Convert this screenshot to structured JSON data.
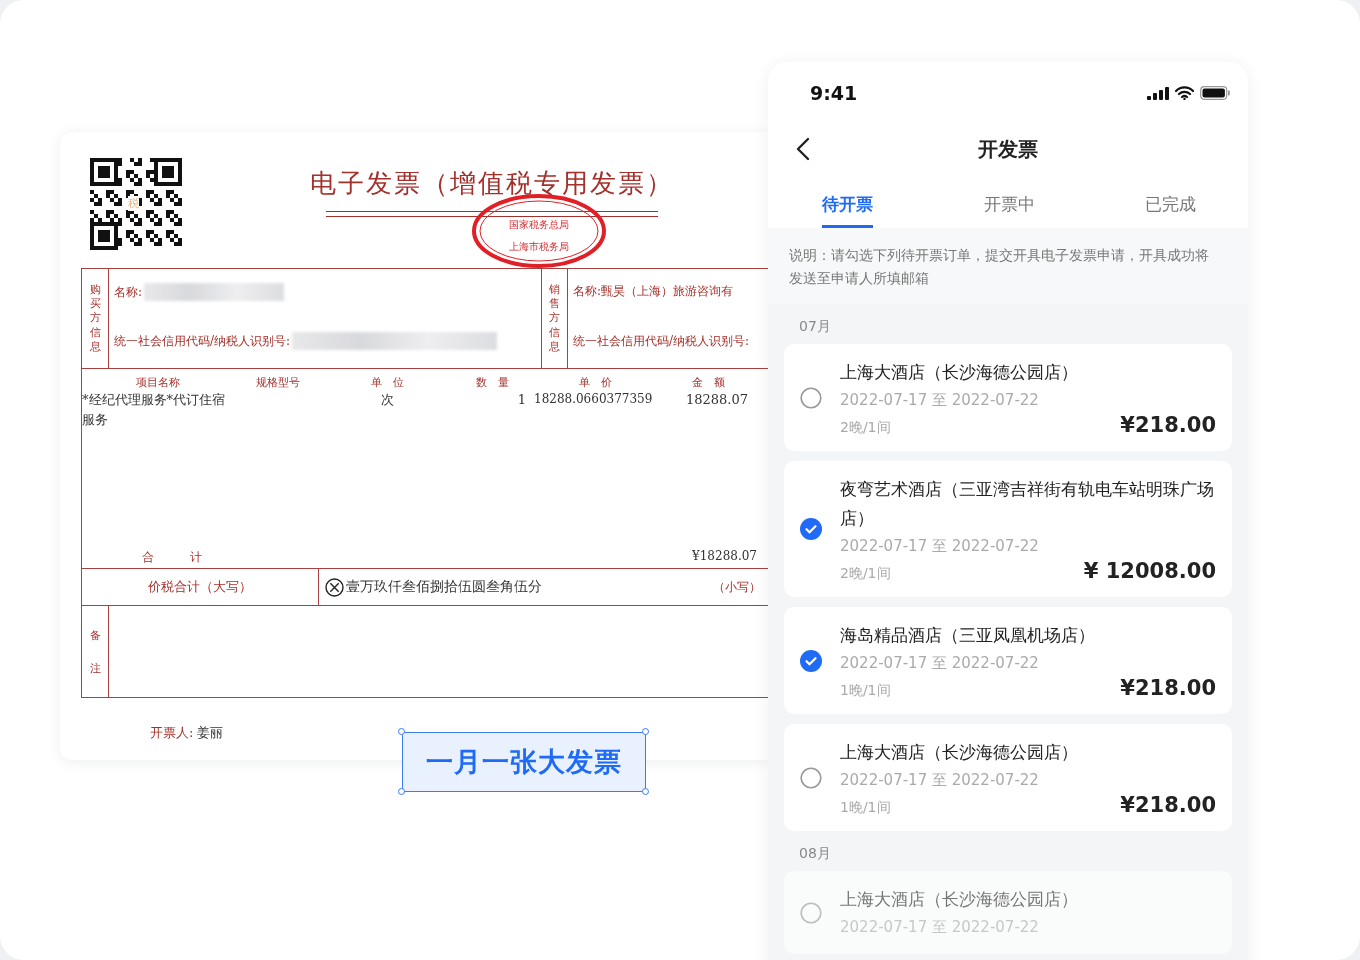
{
  "invoice": {
    "qr_mark": "税",
    "title": "电子发票（增值税专用发票）",
    "stamp": {
      "lines": [
        "国家税务总局",
        "上海市税务局"
      ]
    },
    "buyer": {
      "label": "购买方信息",
      "name_label": "名称:",
      "tax_id_label": "统一社会信用代码/纳税人识别号:"
    },
    "seller": {
      "label": "销售方信息",
      "name": "名称:甄昊（上海）旅游咨询有",
      "tax_id_label": "统一社会信用代码/纳税人识别号:"
    },
    "columns": [
      "项目名称",
      "规格型号",
      "单　位",
      "数　量",
      "单　价",
      "金　额"
    ],
    "rows": [
      {
        "item": "*经纪代理服务*代订住宿服务",
        "spec": "",
        "unit": "次",
        "quantity": "1",
        "price": "18288.0660377359",
        "amount": "18288.07"
      }
    ],
    "total_label": "合　　　计",
    "total": "¥18288.07",
    "grand_label": "价税合计（大写）",
    "grand_words": "壹万玖仟叁佰捌拾伍圆叁角伍分",
    "grand_small_label": "（小写）",
    "remarks_label": "备注",
    "issuer_label": "开票人:",
    "issuer": "姜丽"
  },
  "callout": "一月一张大发票",
  "phone": {
    "time": "9:41",
    "title": "开发票",
    "tabs": [
      {
        "label": "待开票",
        "selected": true
      },
      {
        "label": "开票中",
        "selected": false
      },
      {
        "label": "已完成",
        "selected": false
      }
    ],
    "notice": "说明：请勾选下列待开票订单，提交开具电子发票申请，开具成功将发送至申请人所填邮箱",
    "groups": [
      {
        "month": "07月",
        "orders": [
          {
            "name": "上海大酒店（长沙海德公园店）",
            "dates": "2022-07-17 至 2022-07-22",
            "stay": "2晚/1间",
            "price": "¥218.00",
            "selected": false,
            "faded": false
          },
          {
            "name": "夜弯艺术酒店（三亚湾吉祥街有轨电车站明珠广场店）",
            "dates": "2022-07-17 至 2022-07-22",
            "stay": "2晚/1间",
            "price": "¥ 12008.00",
            "selected": true,
            "faded": false
          },
          {
            "name": "海岛精品酒店（三亚凤凰机场店）",
            "dates": "2022-07-17 至 2022-07-22",
            "stay": "1晚/1间",
            "price": "¥218.00",
            "selected": true,
            "faded": false
          },
          {
            "name": "上海大酒店（长沙海德公园店）",
            "dates": "2022-07-17 至 2022-07-22",
            "stay": "1晚/1间",
            "price": "¥218.00",
            "selected": false,
            "faded": false
          }
        ]
      },
      {
        "month": "08月",
        "orders": [
          {
            "name": "上海大酒店（长沙海德公园店）",
            "dates": "2022-07-17 至 2022-07-22",
            "selected": false,
            "faded": true
          }
        ]
      }
    ]
  }
}
